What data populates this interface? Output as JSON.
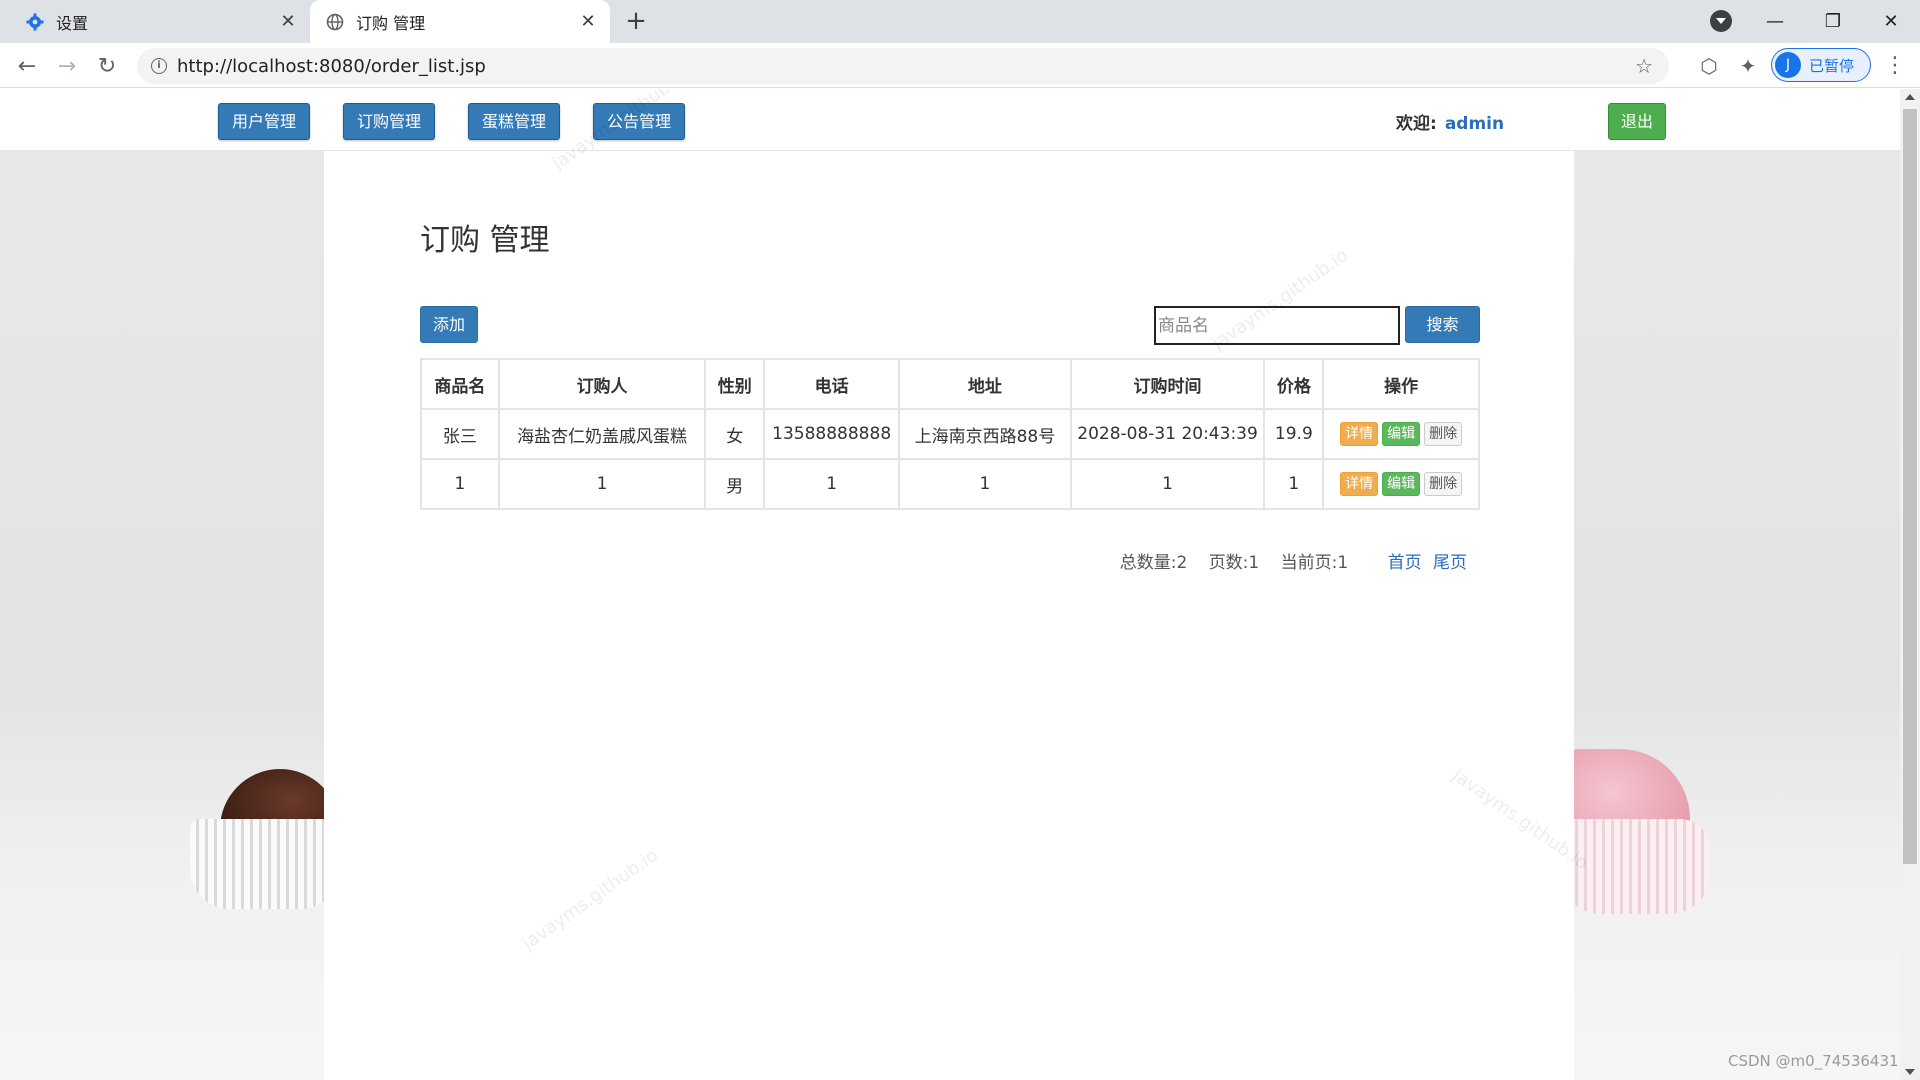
{
  "browser": {
    "tabs": [
      {
        "title": "设置",
        "icon": "gear-icon"
      },
      {
        "title": "订购 管理",
        "icon": "globe-icon"
      }
    ],
    "url": "http://localhost:8080/order_list.jsp",
    "profile_initial": "J",
    "profile_status": "已暂停"
  },
  "nav": {
    "items": [
      "用户管理",
      "订购管理",
      "蛋糕管理",
      "公告管理"
    ],
    "welcome_label": "欢迎:",
    "username": "admin",
    "logout": "退出"
  },
  "page": {
    "title": "订购 管理",
    "add_button": "添加",
    "search_placeholder": "商品名",
    "search_button": "搜索"
  },
  "table": {
    "headers": [
      "商品名",
      "订购人",
      "性别",
      "电话",
      "地址",
      "订购时间",
      "价格",
      "操作"
    ],
    "rows": [
      [
        "张三",
        "海盐杏仁奶盖戚风蛋糕",
        "女",
        "13588888888",
        "上海南京西路88号",
        "2028-08-31 20:43:39",
        "19.9"
      ],
      [
        "1",
        "1",
        "男",
        "1",
        "1",
        "1",
        "1"
      ]
    ],
    "actions": {
      "detail": "详情",
      "edit": "编辑",
      "delete": "删除"
    }
  },
  "pager": {
    "total": "总数量:2",
    "pages": "页数:1",
    "current": "当前页:1",
    "first": "首页",
    "last": "尾页"
  },
  "watermarks": [
    "javayms.github.io"
  ],
  "credit": "CSDN @m0_74536431",
  "colors": {
    "primary": "#337ab7",
    "success": "#5cb85c",
    "warning": "#f0ad4e",
    "link": "#2a6ebb"
  }
}
